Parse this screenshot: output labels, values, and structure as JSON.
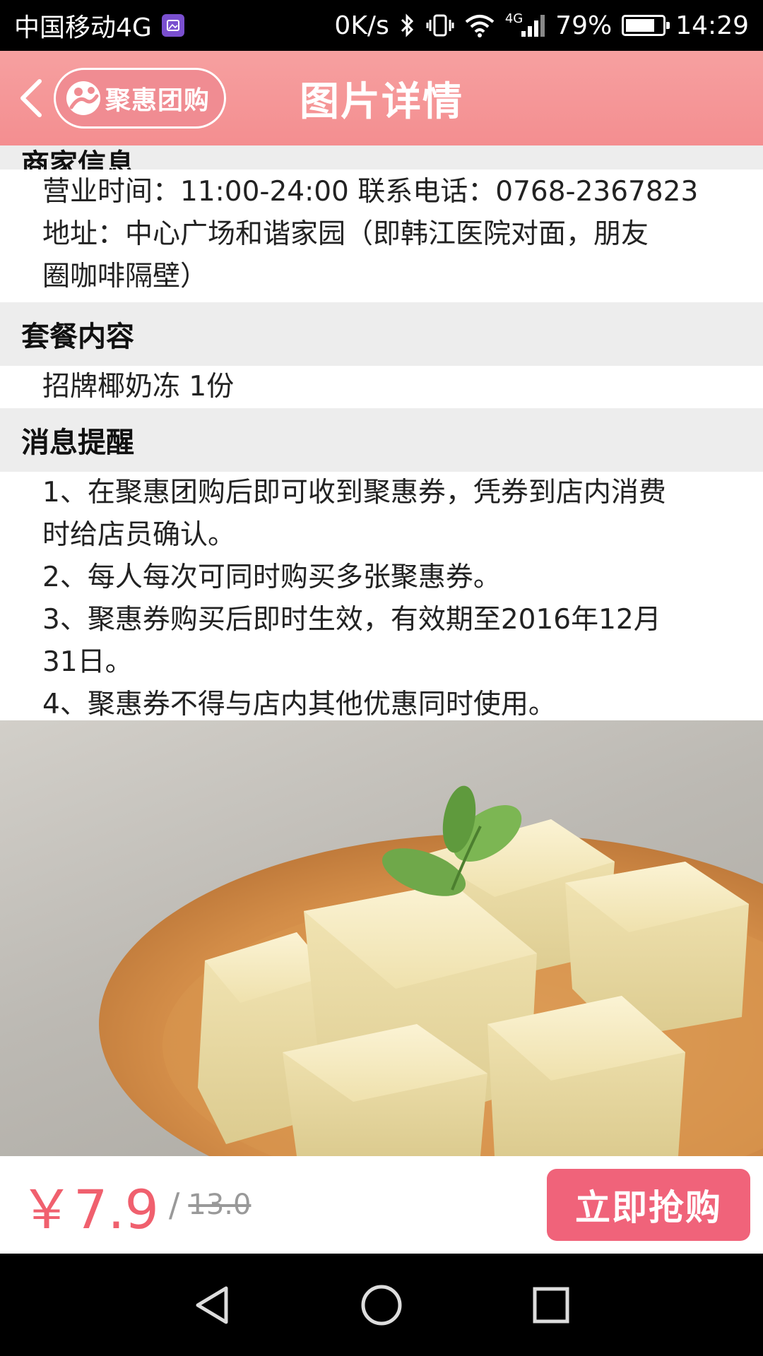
{
  "status_bar": {
    "carrier": "中国移动4G",
    "net_speed": "0K/s",
    "network_badge": "4G",
    "battery": "79%",
    "battery_level": 0.79,
    "time": "14:29"
  },
  "header": {
    "brand": "聚惠团购",
    "title": "图片详情"
  },
  "sections": {
    "shop_info": {
      "heading": "商家信息",
      "hours": "营业时间：11:00-24:00 联系电话：0768-2367823",
      "address_line1": "地址：中心广场和谐家园（即韩江医院对面，朋友",
      "address_line2": "圈咖啡隔壁）"
    },
    "package": {
      "heading": "套餐内容",
      "item": "招牌椰奶冻 1份"
    },
    "notice": {
      "heading": "消息提醒",
      "lines": [
        "1、在聚惠团购后即可收到聚惠券，凭券到店内消费",
        "时给店员确认。",
        "2、每人每次可同时购买多张聚惠券。",
        "3、聚惠券购买后即时生效，有效期至2016年12月",
        "31日。",
        "4、聚惠券不得与店内其他优惠同时使用。"
      ]
    }
  },
  "purchase": {
    "price_now": "￥7.9",
    "separator": "/",
    "price_original": "13.0",
    "buy_label": "立即抢购"
  },
  "icons": {
    "back": "back-arrow-icon",
    "nav_back": "nav-back-icon",
    "nav_home": "nav-home-icon",
    "nav_recents": "nav-recents-icon"
  }
}
